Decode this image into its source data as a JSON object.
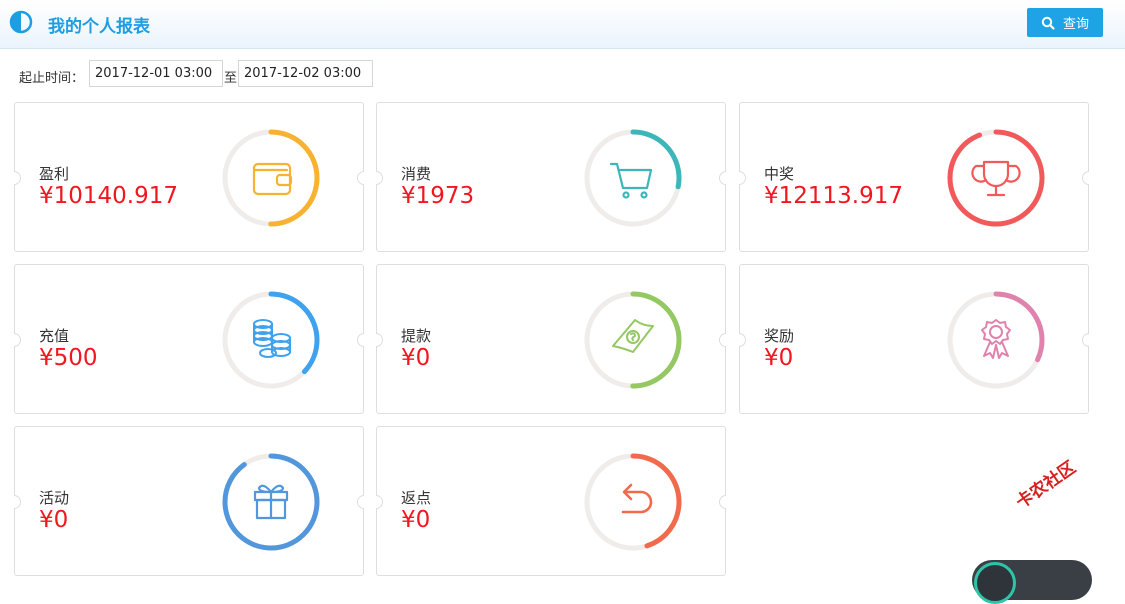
{
  "header": {
    "title": "我的个人报表",
    "logo_icon": "half-circle-icon",
    "query_button": {
      "label": "查询",
      "icon": "search-icon"
    }
  },
  "filter": {
    "label": "起止时间：",
    "start": "2017-12-01 03:00",
    "separator": "至",
    "end": "2017-12-02 03:00"
  },
  "cards": [
    {
      "name": "盈利",
      "amount": "¥10140.917",
      "color": "#f7b232",
      "progress": 0.5,
      "icon": "wallet-icon"
    },
    {
      "name": "消费",
      "amount": "¥1973",
      "color": "#3db6ba",
      "progress": 0.28,
      "icon": "shopping-cart-icon"
    },
    {
      "name": "中奖",
      "amount": "¥12113.917",
      "color": "#f2595a",
      "progress": 0.94,
      "icon": "trophy-icon"
    },
    {
      "name": "充值",
      "amount": "¥500",
      "color": "#3ea2ee",
      "progress": 0.37,
      "icon": "coins-icon"
    },
    {
      "name": "提款",
      "amount": "¥0",
      "color": "#93c862",
      "progress": 0.5,
      "icon": "money-bill-icon"
    },
    {
      "name": "奖励",
      "amount": "¥0",
      "color": "#df82ad",
      "progress": 0.32,
      "icon": "award-ribbon-icon"
    },
    {
      "name": "活动",
      "amount": "¥0",
      "color": "#5296dc",
      "progress": 0.9,
      "icon": "gift-icon"
    },
    {
      "name": "返点",
      "amount": "¥0",
      "color": "#f16a4c",
      "progress": 0.45,
      "icon": "return-arrow-icon"
    }
  ],
  "ring_track_color": "#f0ece9",
  "watermark": "卡农社区"
}
